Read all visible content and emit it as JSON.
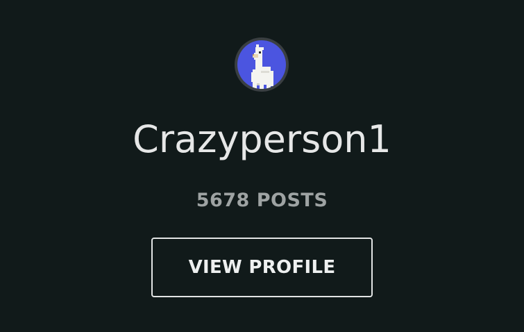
{
  "profile": {
    "avatar_icon": "llama-avatar-icon",
    "avatar_bg": "#4b55e0",
    "username": "Crazyperson1",
    "posts": "5678 POSTS",
    "view_profile_label": "VIEW PROFILE"
  },
  "colors": {
    "background": "#111a1a",
    "text_primary": "#e6e7e7",
    "text_secondary": "#9ea3a3"
  }
}
